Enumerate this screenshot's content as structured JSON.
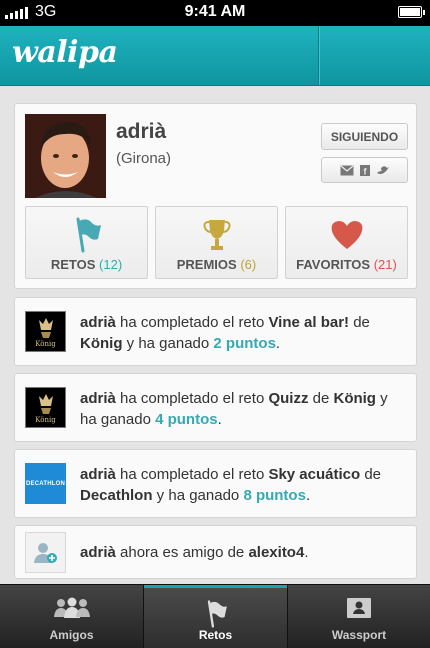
{
  "status_bar": {
    "carrier": "3G",
    "time": "9:41 AM"
  },
  "header": {
    "logo": "walipa"
  },
  "profile": {
    "name": "adrià",
    "location": "(Girona)",
    "follow_button": "SIGUIENDO",
    "share_icons": [
      "mail-icon",
      "facebook-icon",
      "twitter-icon"
    ],
    "stats": [
      {
        "label": "RETOS",
        "count": "(12)",
        "icon": "flag-icon",
        "count_color": "#34aab4"
      },
      {
        "label": "PREMIOS",
        "count": "(6)",
        "icon": "trophy-icon",
        "count_color": "#b9a23a"
      },
      {
        "label": "FAVORITOS",
        "count": "(21)",
        "icon": "heart-icon",
        "count_color": "#d5584a"
      }
    ]
  },
  "feed": [
    {
      "user": "adrià",
      "t1": " ha completado el reto ",
      "reto": "Vine al bar!",
      "t2": " de ",
      "brand": "König",
      "t3": " y ha ganado ",
      "points": "2 puntos",
      "t4": ".",
      "thumb": "konig-logo",
      "thumb_label": "König"
    },
    {
      "user": "adrià",
      "t1": " ha completado el reto ",
      "reto": "Quizz",
      "t2": " de ",
      "brand": "König",
      "t3": " y ha ganado ",
      "points": "4 puntos",
      "t4": ".",
      "thumb": "konig-logo",
      "thumb_label": "König"
    },
    {
      "user": "adrià",
      "t1": " ha completado el reto ",
      "reto": "Sky acuático",
      "t2": " de ",
      "brand": "Decathlon",
      "t3": " y ha ganado ",
      "points": "8 puntos",
      "t4": ".",
      "thumb": "decathlon-logo",
      "thumb_label": "DECATHLON"
    },
    {
      "user": "adrià",
      "t1": " ahora es amigo de ",
      "friend": "alexito4",
      "t2": ".",
      "thumb": "add-friend-icon"
    }
  ],
  "tabs": [
    {
      "label": "Amigos",
      "icon": "people-icon",
      "active": false
    },
    {
      "label": "Retos",
      "icon": "flag-icon",
      "active": true
    },
    {
      "label": "Wassport",
      "icon": "id-card-icon",
      "active": false
    }
  ],
  "colors": {
    "accent": "#1fb3bf",
    "points": "#34aab4"
  }
}
